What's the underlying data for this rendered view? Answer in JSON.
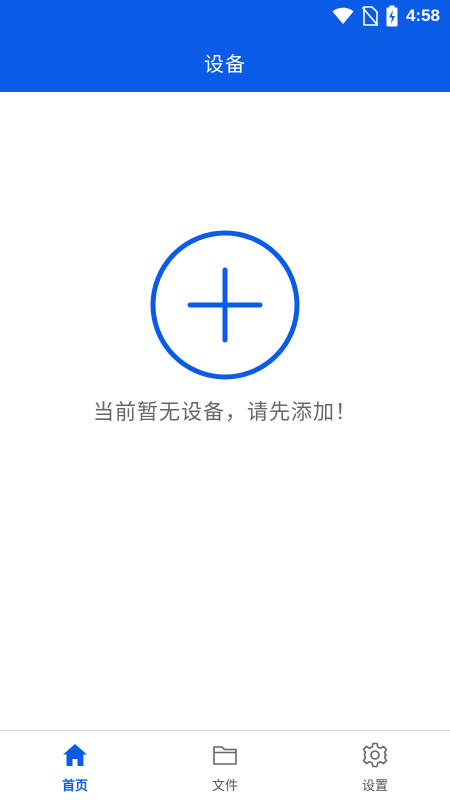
{
  "colors": {
    "primary": "#0a5ce6",
    "text_muted": "#666666",
    "nav_inactive": "#555555"
  },
  "status_bar": {
    "time": "4:58",
    "icons": [
      "wifi-icon",
      "no-sim-icon",
      "battery-charging-icon"
    ]
  },
  "app_bar": {
    "title": "设备"
  },
  "empty_state": {
    "add_icon": "plus-circle-icon",
    "message": "当前暂无设备，请先添加！"
  },
  "bottom_nav": {
    "items": [
      {
        "label": "首页",
        "icon": "home-icon",
        "active": true
      },
      {
        "label": "文件",
        "icon": "folder-icon",
        "active": false
      },
      {
        "label": "设置",
        "icon": "gear-icon",
        "active": false
      }
    ]
  }
}
